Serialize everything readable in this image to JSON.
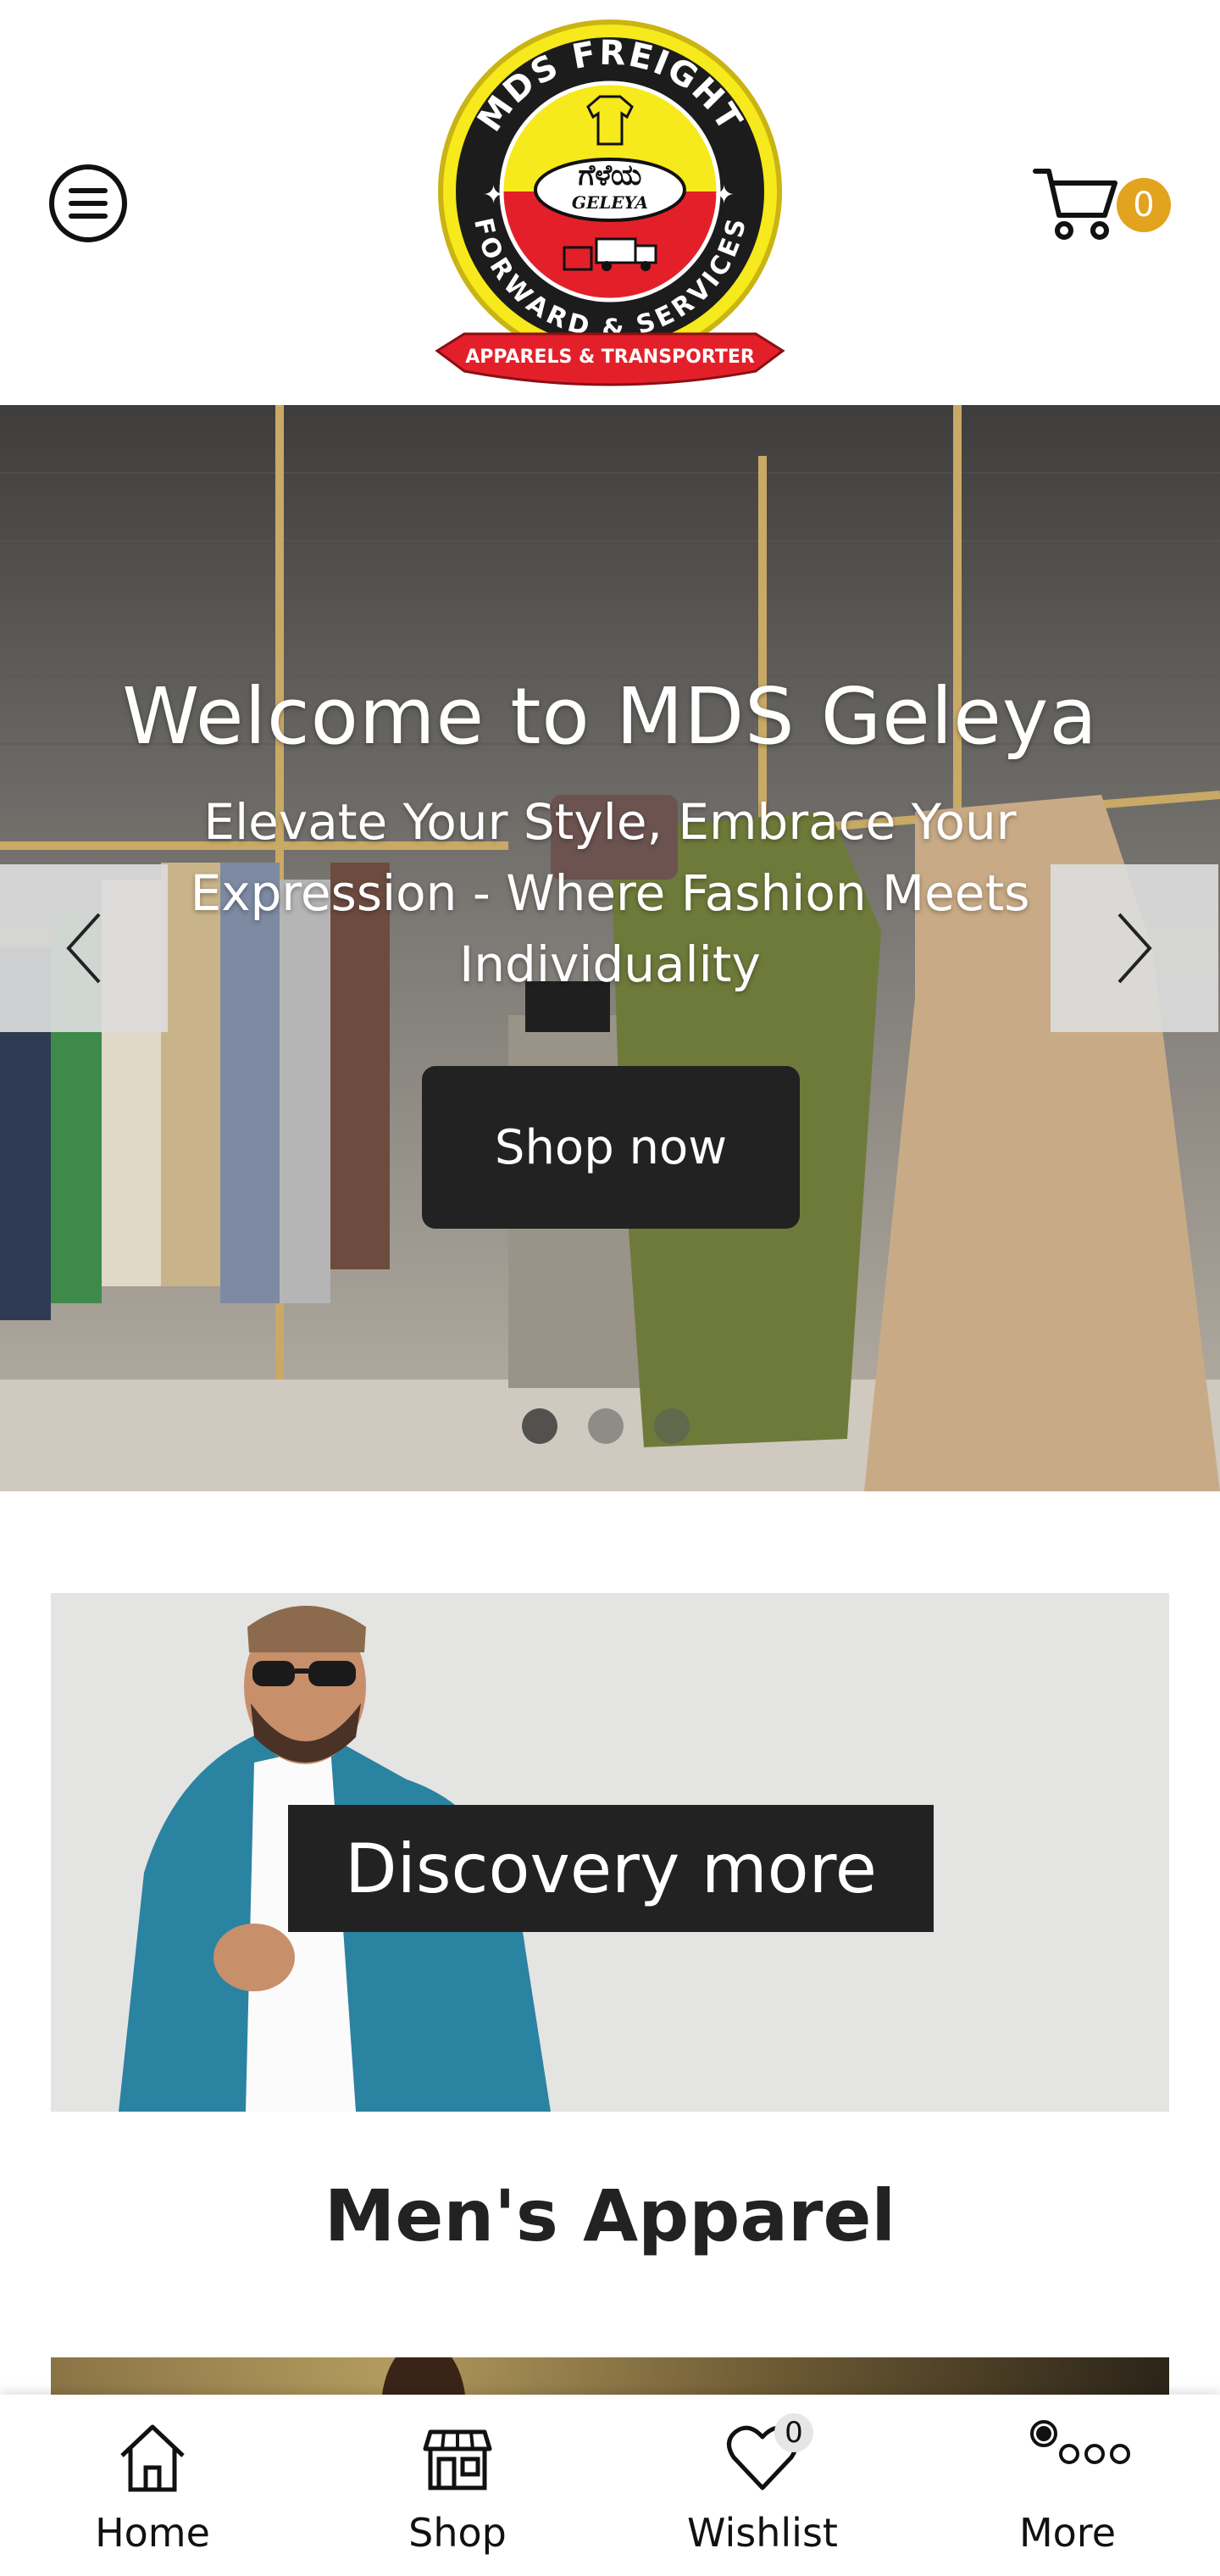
{
  "header": {
    "menu_icon": "hamburger-menu-icon",
    "logo": {
      "top_text": "MDS FREIGHT",
      "center_kannada": "ಗೆಳೆಯ",
      "center_latin": "GELEYA",
      "bottom_text": "FORWARD & SERVICES",
      "ribbon_text": "APPARELS & TRANSPORTER"
    },
    "cart_icon": "shopping-cart-icon",
    "cart_count": "0"
  },
  "hero": {
    "title": "Welcome to MDS Geleya",
    "subtitle": "Elevate Your Style, Embrace Your Expression - Where Fashion Meets Individuality",
    "cta": "Shop now",
    "prev_icon": "chevron-left-icon",
    "next_icon": "chevron-right-icon",
    "slide_count": 3,
    "active_slide": 1
  },
  "banner": {
    "cta": "Discovery more",
    "category_title": "Men's Apparel"
  },
  "bottom_nav": {
    "items": [
      {
        "label": "Home",
        "icon": "home-icon"
      },
      {
        "label": "Shop",
        "icon": "store-icon"
      },
      {
        "label": "Wishlist",
        "icon": "heart-icon",
        "badge": "0"
      },
      {
        "label": "More",
        "icon": "more-dots-icon"
      }
    ]
  },
  "colors": {
    "accent": "#e2a31f",
    "dark_button": "#222222",
    "logo_yellow": "#f6e91c",
    "logo_red": "#e3202a"
  }
}
